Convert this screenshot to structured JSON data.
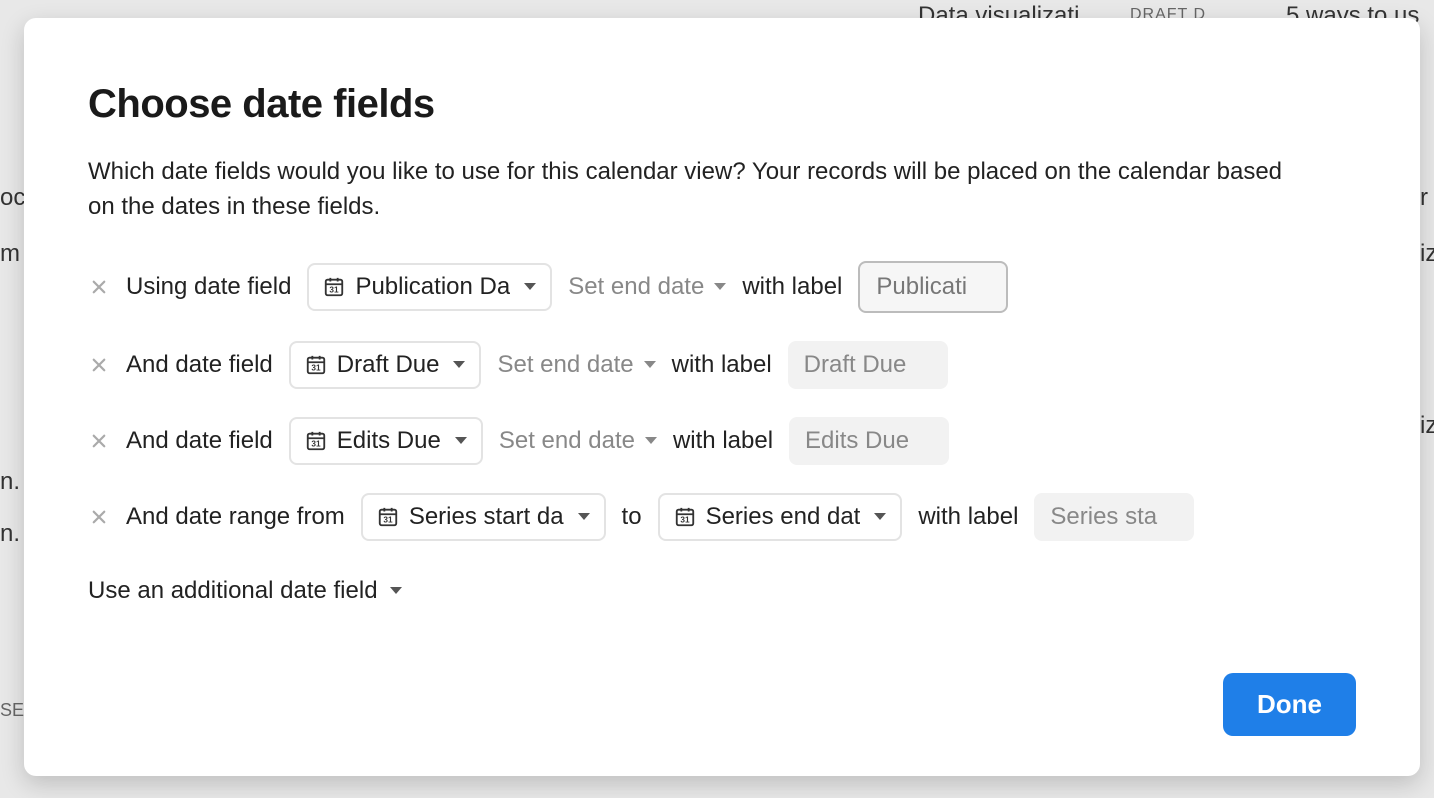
{
  "modal": {
    "title": "Choose date fields",
    "description": "Which date fields would you like to use for this calendar view? Your records will be placed on the calendar based on the dates in these fields.",
    "rows": [
      {
        "prefix": "Using date field",
        "field": "Publication Da",
        "set_end": "Set end date",
        "with_label": "with label",
        "label_value": "Publicati",
        "label_active": true
      },
      {
        "prefix": "And date field",
        "field": "Draft Due",
        "set_end": "Set end date",
        "with_label": "with label",
        "label_value": "Draft Due",
        "label_active": false
      },
      {
        "prefix": "And date field",
        "field": "Edits Due",
        "set_end": "Set end date",
        "with_label": "with label",
        "label_value": "Edits Due",
        "label_active": false
      }
    ],
    "range_row": {
      "prefix": "And date range from",
      "start_field": "Series start da",
      "to": "to",
      "end_field": "Series end dat",
      "with_label": "with label",
      "label_value": "Series sta"
    },
    "add_more": "Use an additional date field",
    "done": "Done"
  },
  "background": {
    "top_card_title": "Data visualizati",
    "top_card_badge": "DRAFT D",
    "top_right": "5 ways to us",
    "left_frag_1": "oc",
    "left_frag_2": "m",
    "left_frag_3": "n.",
    "left_frag_4": "n.",
    "left_frag_5": "SE",
    "right_frag_1": "r",
    "right_frag_2": "iz",
    "right_frag_3": "iz"
  }
}
